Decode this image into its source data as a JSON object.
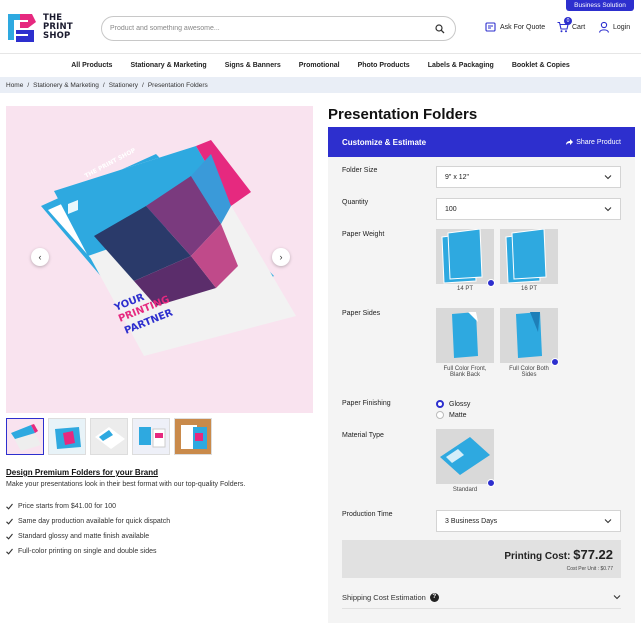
{
  "header": {
    "business_button": "Business Solution",
    "logo_line1": "THE",
    "logo_line2": "PRINT",
    "logo_line3": "SHOP",
    "search_placeholder": "Product and something awesome...",
    "ask_quote": "Ask For Quote",
    "cart": "Cart",
    "cart_count": "0",
    "login": "Login"
  },
  "nav": {
    "items": [
      "All Products",
      "Stationary & Marketing",
      "Signs & Banners",
      "Promotional",
      "Photo Products",
      "Labels & Packaging",
      "Booklet & Copies"
    ]
  },
  "breadcrumb": [
    "Home",
    "Stationery & Marketing",
    "Stationery",
    "Presentation Folders"
  ],
  "breadcrumb_sep": "/",
  "gallery": {
    "prev": "‹",
    "next": "›",
    "folder_tagline": "YOUR PRINTING PARTNER",
    "folder_tagline_l1": "YOUR",
    "folder_tagline_l2": "PRINTING",
    "folder_tagline_l3": "PARTNER"
  },
  "description": {
    "title": "Design Premium Folders for your Brand",
    "text": "Make your presentations look in their best format with our top-quality Folders.",
    "features": [
      "Price starts from $41.00 for 100",
      "Same day production available for quick dispatch",
      "Standard glossy and matte finish available",
      "Full-color printing on single and double sides"
    ]
  },
  "product": {
    "title": "Presentation Folders",
    "customize": "Customize & Estimate",
    "share": "Share Product",
    "folder_size_label": "Folder Size",
    "folder_size_value": "9\" x 12\"",
    "quantity_label": "Quantity",
    "quantity_value": "100",
    "paper_weight_label": "Paper Weight",
    "weights": [
      "14 PT",
      "16 PT"
    ],
    "paper_sides_label": "Paper Sides",
    "sides": [
      "Full Color Front, Blank Back",
      "Full Color Both Sides"
    ],
    "sides_0_l1": "Full Color Front,",
    "sides_0_l2": "Blank Back",
    "sides_1_l1": "Full Color Both",
    "sides_1_l2": "Sides",
    "finishing_label": "Paper Finishing",
    "finishes": [
      "Glossy",
      "Matte"
    ],
    "material_label": "Material Type",
    "material": "Standard",
    "production_label": "Production Time",
    "production_value": "3 Business Days",
    "printing_cost_label": "Printing Cost:",
    "printing_cost": "$77.22",
    "cost_per_unit": "Cost Per Unit : $0.77",
    "shipping": "Shipping Cost Estimation",
    "help_glyph": "?"
  },
  "colors": {
    "accent": "#2d2fce",
    "pink": "#e6297f",
    "cyan": "#2ea9e0"
  }
}
